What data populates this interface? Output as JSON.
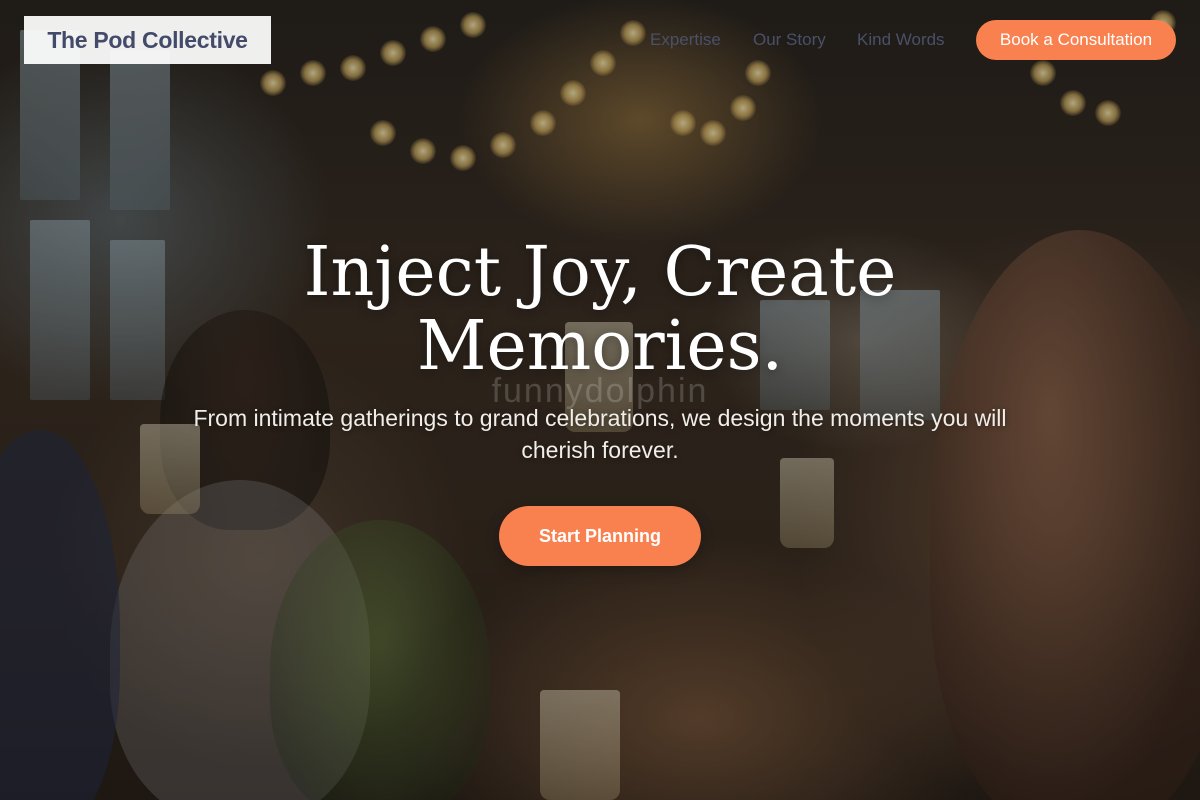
{
  "brand": {
    "name": "The Pod Collective",
    "accent_color": "#f9814f",
    "logo_text_color": "#444a6a"
  },
  "nav": {
    "links": [
      "Expertise",
      "Our Story",
      "Kind Words"
    ],
    "cta_label": "Book a Consultation"
  },
  "hero": {
    "headline_line1": "Inject Joy, Create",
    "headline_line2": "Memories.",
    "subheadline": "From intimate gatherings to grand celebrations, we design the moments you will cherish forever.",
    "cta_label": "Start Planning",
    "background_image": "wedding-toast-photo",
    "watermark_text": "funnydolphin"
  }
}
